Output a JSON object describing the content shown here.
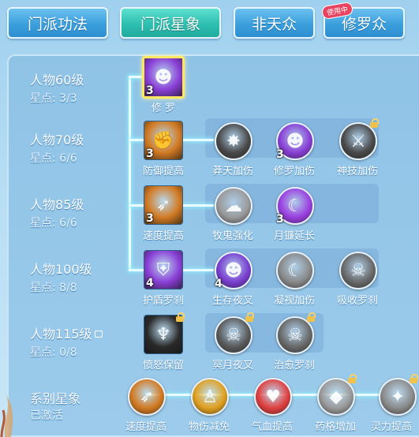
{
  "tabs": [
    {
      "label": "门派功法",
      "active": false
    },
    {
      "label": "门派星象",
      "active": true
    },
    {
      "label": "非天众",
      "active": false
    },
    {
      "label": "修罗众",
      "active": false,
      "badge": "使用中"
    }
  ],
  "rows": [
    {
      "level": "人物60级",
      "points": "星点: 3/3"
    },
    {
      "level": "人物70级",
      "points": "星点: 6/6"
    },
    {
      "level": "人物85级",
      "points": "星点: 6/6"
    },
    {
      "level": "人物100级",
      "points": "星点: 8/8"
    },
    {
      "level": "人物115级",
      "points": "星点: 0/8",
      "locked": true
    },
    {
      "level": "系别星象",
      "points": "已激活"
    }
  ],
  "skills": {
    "xiuluo": {
      "label": "修 罗",
      "count": "3",
      "color": "#8a3fd6",
      "icon": "demon-face-icon"
    },
    "fangyu": {
      "label": "防御提高",
      "count": "3",
      "color": "#d27a22",
      "icon": "arm-icon"
    },
    "mangtian": {
      "label": "莽天加伤",
      "color": "#4a4a4a",
      "icon": "burst-icon"
    },
    "xiuluojs": {
      "label": "修罗加伤",
      "count": "3",
      "color": "#8a3fd6",
      "icon": "demon-face-icon"
    },
    "shenji": {
      "label": "神技加伤",
      "color": "#4a4a4a",
      "icon": "claw-icon",
      "locked": true
    },
    "sudu": {
      "label": "速度提高",
      "count": "3",
      "color": "#d27a22",
      "icon": "boot-icon"
    },
    "mugui": {
      "label": "牧鬼强化",
      "color": "#9a9a9a",
      "icon": "ghost-icon"
    },
    "yuelian": {
      "label": "月镰延长",
      "count": "3",
      "color": "#9b3fe0",
      "icon": "sickle-icon"
    },
    "hudun": {
      "label": "护盾罗刹",
      "count": "4",
      "color": "#8a3fd6",
      "icon": "shield-icon"
    },
    "shengcun": {
      "label": "生存夜叉",
      "count": "4",
      "color": "#7a3fd0",
      "icon": "demon-face-icon"
    },
    "ningshi": {
      "label": "凝视加伤",
      "color": "#8a8a8a",
      "icon": "crescent-icon"
    },
    "xishou": {
      "label": "吸收罗刹",
      "color": "#6a6a6a",
      "icon": "demon-head-icon"
    },
    "fennu": {
      "label": "愤怒保留",
      "color": "#2a2a2a",
      "icon": "warrior-icon",
      "locked": true
    },
    "mingyue": {
      "label": "冥月夜叉",
      "color": "#5a5a5a",
      "icon": "demon-head-icon",
      "locked": true
    },
    "zhiyu": {
      "label": "治愈罗刹",
      "color": "#6a6a6a",
      "icon": "demon-head-icon",
      "locked": true
    },
    "b_sudu": {
      "label": "速度提高",
      "color": "#d27a22",
      "icon": "boot-icon"
    },
    "b_wushang": {
      "label": "物伤减免",
      "color": "#e0a020",
      "icon": "figure-icon"
    },
    "b_qixue": {
      "label": "气血提高",
      "color": "#e04040",
      "icon": "heart-icon"
    },
    "b_yaoge": {
      "label": "药格增加",
      "color": "#9a9a9a",
      "icon": "gem-icon",
      "locked": true
    },
    "b_lingli": {
      "label": "灵力提高",
      "color": "#8a8a8a",
      "icon": "spark-icon",
      "locked": true
    }
  }
}
